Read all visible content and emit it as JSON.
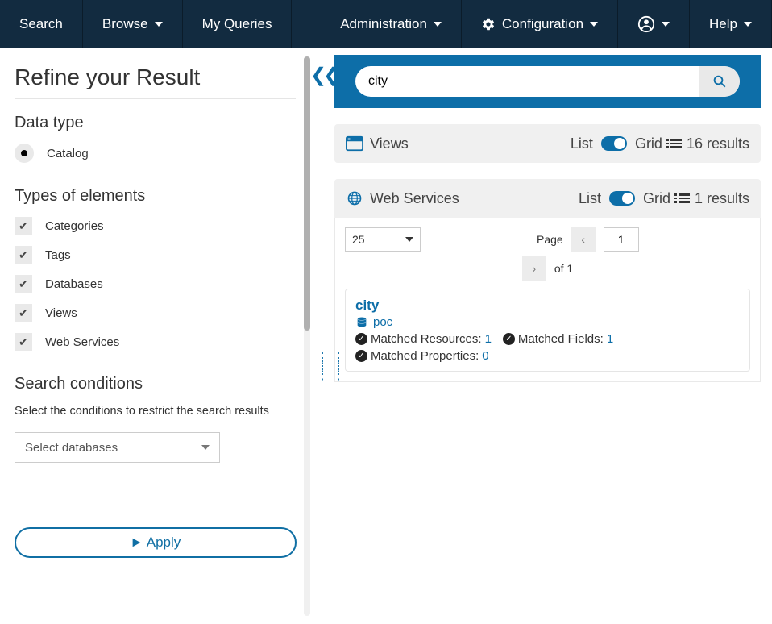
{
  "nav": {
    "search": "Search",
    "browse": "Browse",
    "my_queries": "My Queries",
    "administration": "Administration",
    "configuration": "Configuration",
    "help": "Help"
  },
  "sidebar": {
    "title": "Refine your Result",
    "data_type_heading": "Data type",
    "data_type_option": "Catalog",
    "types_heading": "Types of elements",
    "types": {
      "categories": "Categories",
      "tags": "Tags",
      "databases": "Databases",
      "views": "Views",
      "web_services": "Web Services"
    },
    "conditions_heading": "Search conditions",
    "conditions_help": "Select the conditions to restrict the search results",
    "select_db_placeholder": "Select databases",
    "apply": "Apply"
  },
  "search": {
    "value": "city"
  },
  "sections": {
    "views": {
      "title": "Views",
      "list_label": "List",
      "grid_label": "Grid",
      "results_count": "16 results"
    },
    "web_services": {
      "title": "Web Services",
      "list_label": "List",
      "grid_label": "Grid",
      "results_count": "1 results",
      "page_label": "Page",
      "of_label": "of 1",
      "page_size": "25",
      "page_current": "1"
    }
  },
  "result": {
    "title": "city",
    "parent_db": "poc",
    "matched_resources_label": "Matched Resources:",
    "matched_resources_val": "1",
    "matched_fields_label": "Matched Fields:",
    "matched_fields_val": "1",
    "matched_props_label": "Matched Properties:",
    "matched_props_val": "0"
  }
}
